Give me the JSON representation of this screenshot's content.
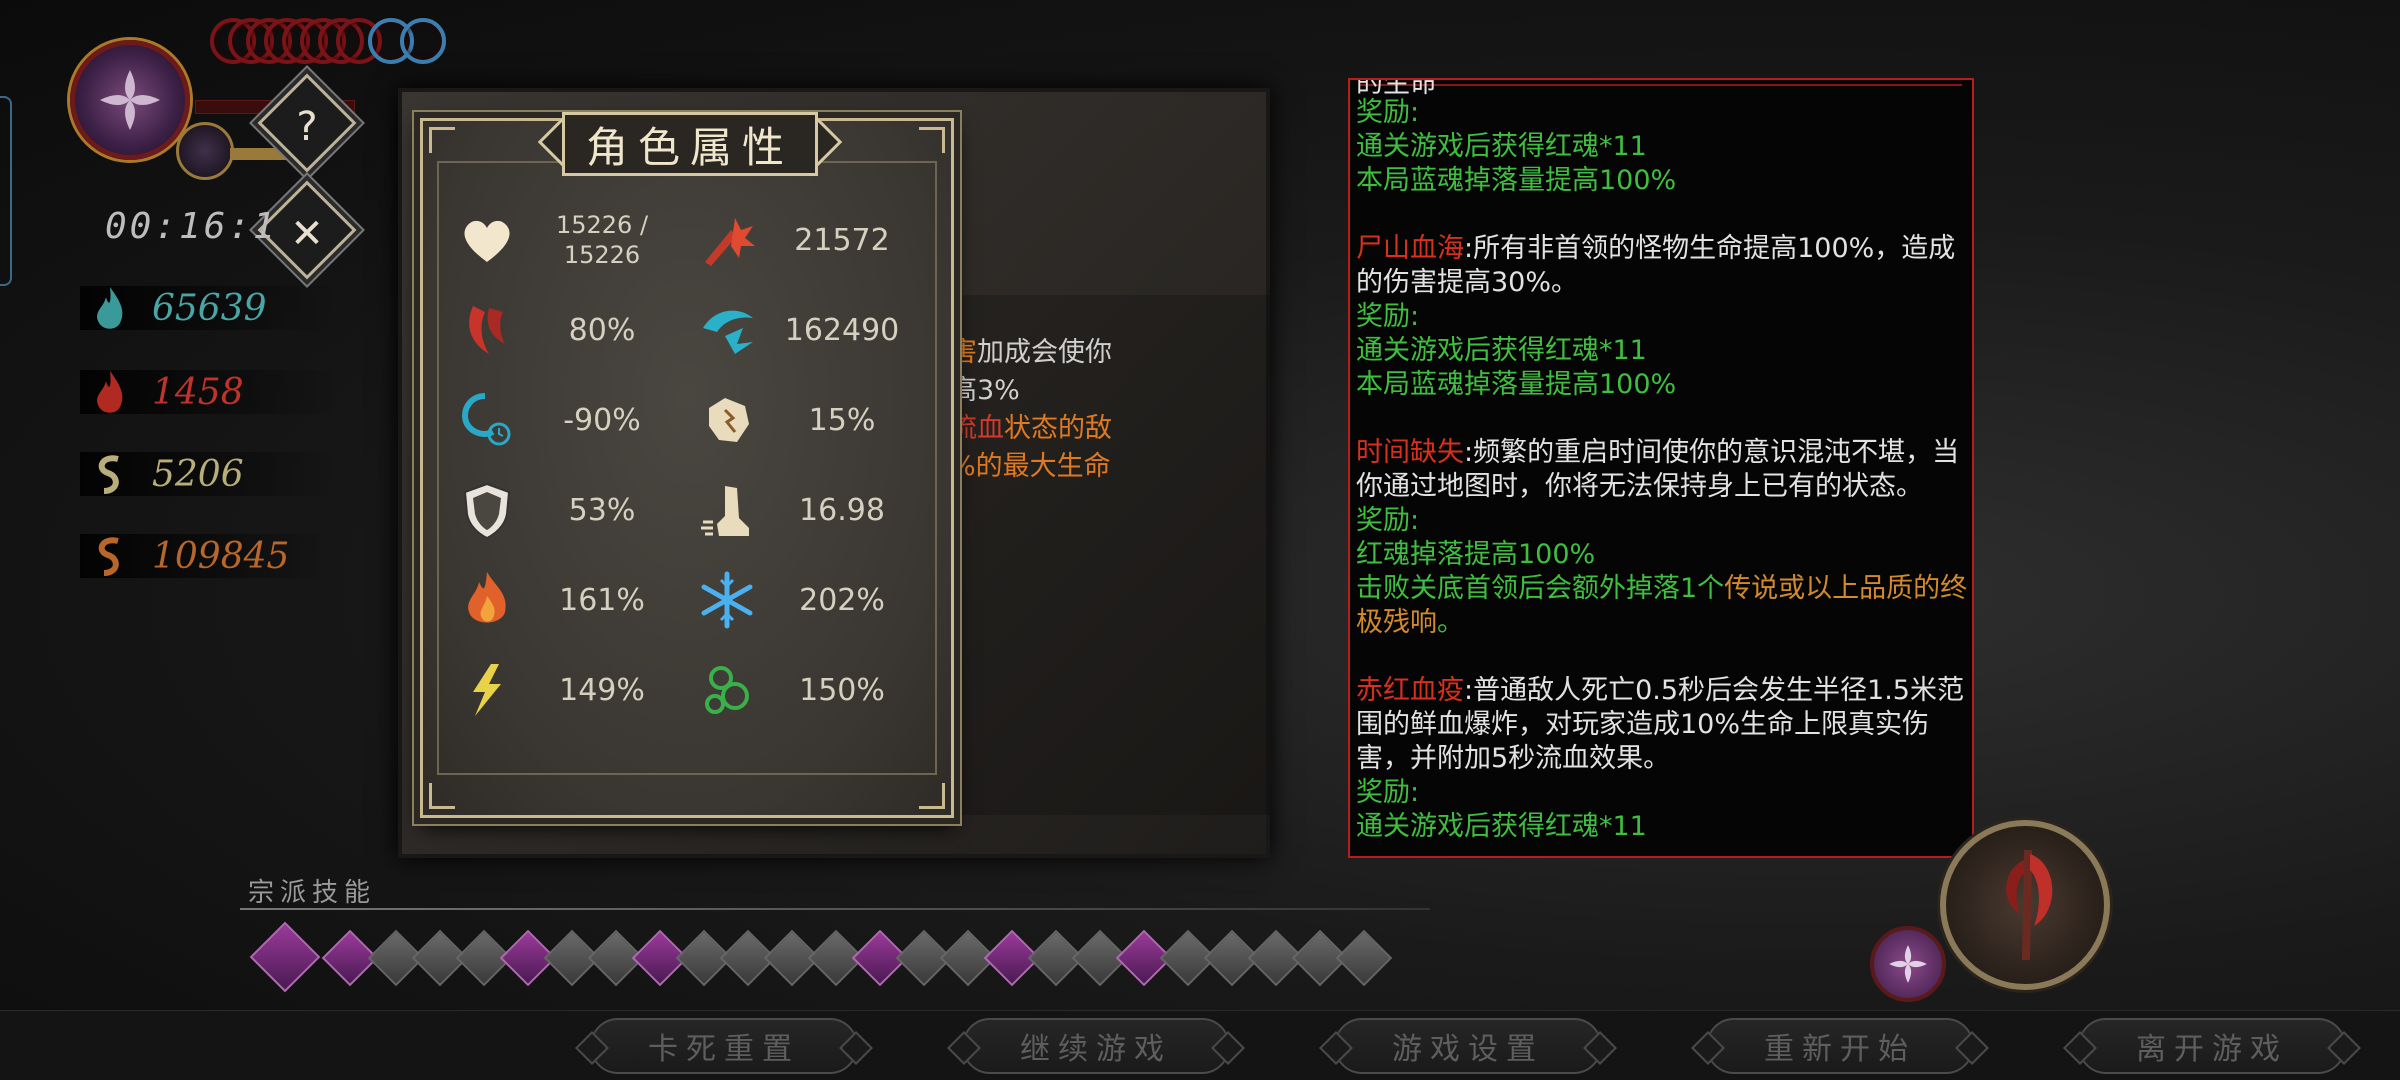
{
  "hud": {
    "timer": "00:16:1",
    "help_icon": "?",
    "close_icon": "✕",
    "stats": [
      {
        "icon": "blue-soul-icon",
        "value": "65639",
        "color": "#4aa6a6"
      },
      {
        "icon": "red-soul-icon",
        "value": "1458",
        "color": "#c0332b"
      },
      {
        "icon": "gold-swirl-icon",
        "value": "5206",
        "color": "#b8ae7a"
      },
      {
        "icon": "orange-swirl-icon",
        "value": "109845",
        "color": "#b8672a"
      }
    ]
  },
  "attr_panel": {
    "title": "角色属性",
    "cells": [
      {
        "icon": "heart-icon",
        "value_line1": "15226 /",
        "value_line2": "15226"
      },
      {
        "icon": "attack-burst-icon",
        "value": "21572"
      },
      {
        "icon": "crit-claw-icon",
        "value": "80%"
      },
      {
        "icon": "blue-claw-icon",
        "value": "162490"
      },
      {
        "icon": "cooldown-icon",
        "value": "-90%"
      },
      {
        "icon": "lifesteal-hand-icon",
        "value": "15%"
      },
      {
        "icon": "shield-icon",
        "value": "53%"
      },
      {
        "icon": "speed-boot-icon",
        "value": "16.98"
      },
      {
        "icon": "fire-icon",
        "value": "161%"
      },
      {
        "icon": "frost-icon",
        "value": "202%"
      },
      {
        "icon": "lightning-icon",
        "value": "149%"
      },
      {
        "icon": "poison-icon",
        "value": "150%"
      }
    ]
  },
  "behind_panel": {
    "line1_orange": "害",
    "line1_white": "加成会使你",
    "line2": "高3%",
    "line3_red": "流血",
    "line3_orange": "状态的敌",
    "line4": "%的最大生命"
  },
  "description": {
    "top_cut": "的生命",
    "p1": {
      "reward_label": "奖励:",
      "r1": "通关游戏后获得红魂*11",
      "r2": "本局蓝魂掉落量提高100%"
    },
    "p2": {
      "name": "尸山血海",
      "text": ":所有非首领的怪物生命提高100%，造成的伤害提高30%。",
      "reward_label": "奖励:",
      "r1": "通关游戏后获得红魂*11",
      "r2": "本局蓝魂掉落量提高100%"
    },
    "p3": {
      "name": "时间缺失",
      "text": ":频繁的重启时间使你的意识混沌不堪，当你通过地图时，你将无法保持身上已有的状态。",
      "reward_label": "奖励:",
      "r1": "红魂掉落提高100%",
      "r2a": "击败关底首领后会额外掉落1个",
      "r2b": "传说或以上品质的终极残响",
      "r2c": "。"
    },
    "p4": {
      "name": "赤红血疫",
      "text": ":普通敌人死亡0.5秒后会发生半径1.5米范围的鲜血爆炸，对玩家造成10%生命上限真实伤害，并附加5秒流血效果。",
      "reward_label": "奖励:",
      "r1": "通关游戏后获得红魂*11"
    }
  },
  "skills": {
    "label": "宗派技能"
  },
  "menu": {
    "buttons": [
      "卡死重置",
      "继续游戏",
      "游戏设置",
      "重新开始",
      "离开游戏"
    ]
  },
  "colors": {
    "reward_green": "#3fbf3f",
    "curse_red": "#d8301e",
    "legend_orange": "#d28a2a",
    "panel_border": "#b81c1c"
  }
}
